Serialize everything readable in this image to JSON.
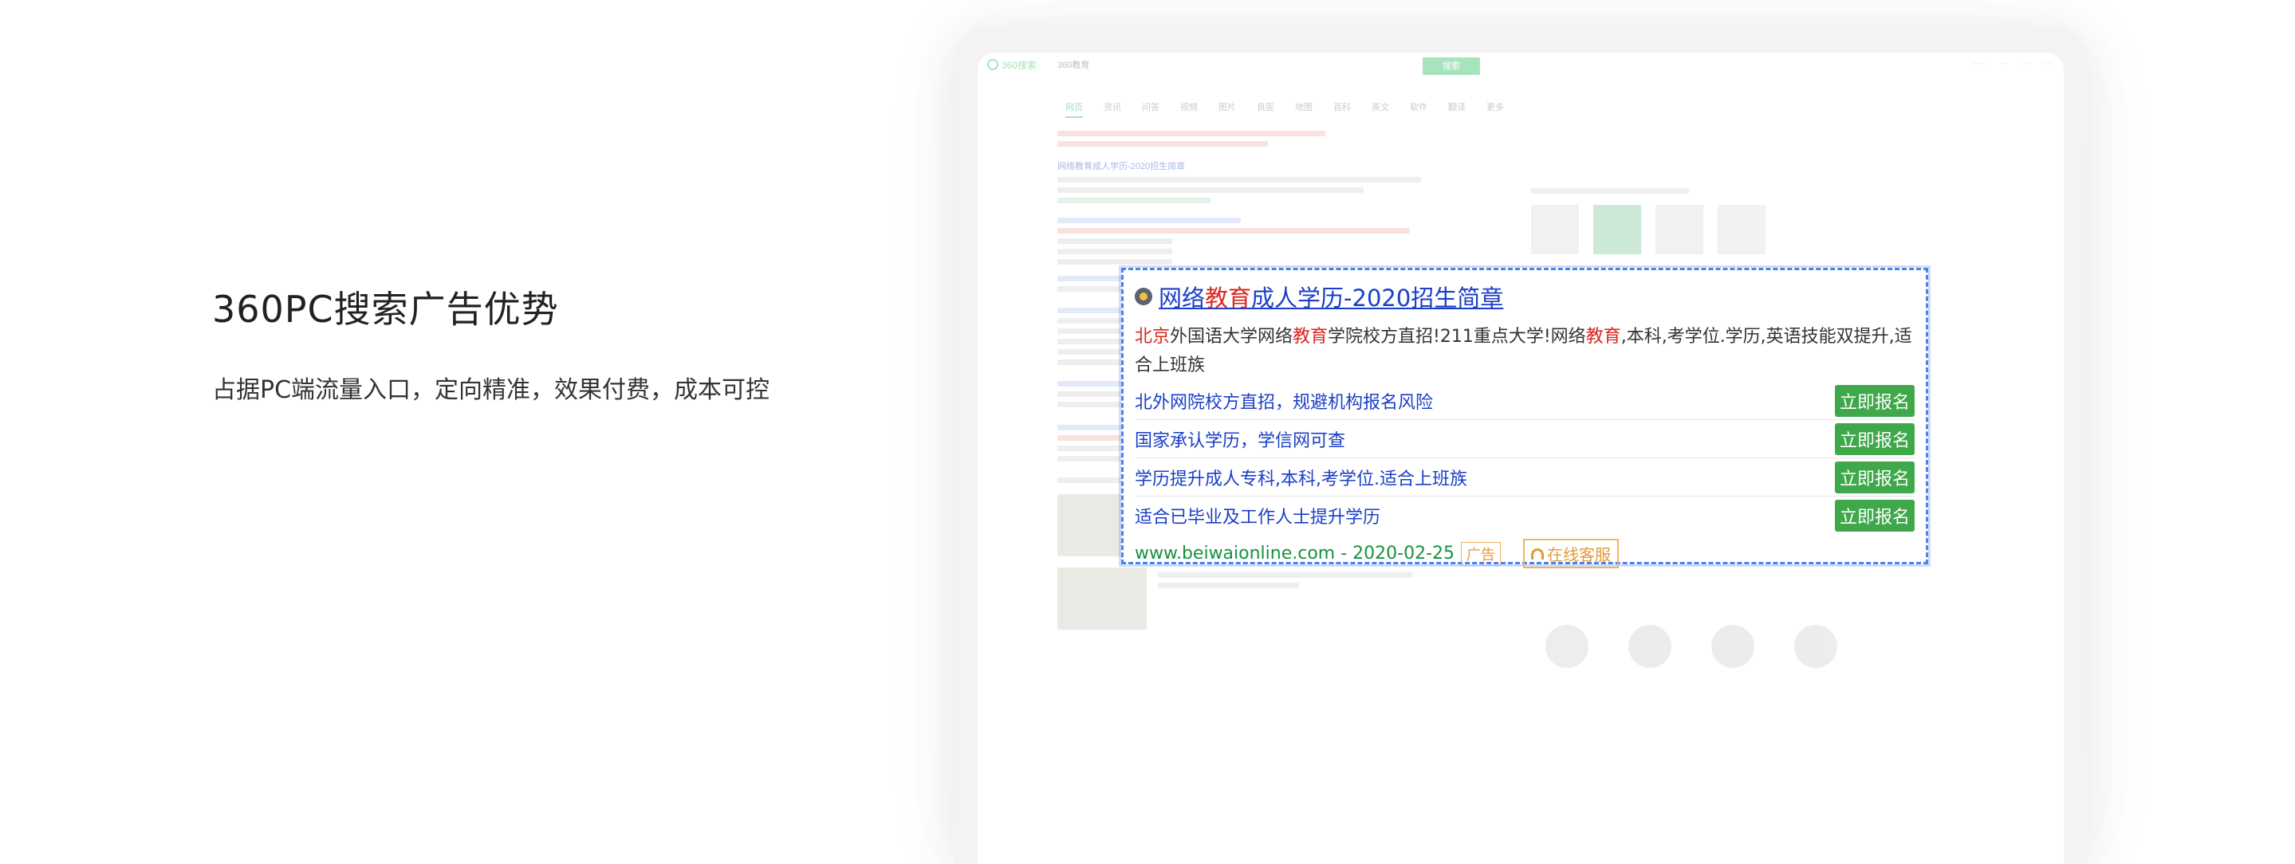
{
  "intro": {
    "title": "360PC搜索广告优势",
    "subtitle": "占据PC端流量入口，定向精准，效果付费，成本可控"
  },
  "ad": {
    "title_parts": [
      "网络",
      "教育",
      "成人学历-2020招生简章"
    ],
    "description_parts": [
      "北京",
      "外国语大学网络",
      "教育",
      "学院校方直招!211重点大学!网络",
      "教育",
      ",本科,考学位.学历,英语技能双提升,适合上班族"
    ],
    "sitelinks": [
      {
        "label": "北外网院校方直招，规避机构报名风险",
        "button": "立即报名"
      },
      {
        "label": "国家承认学历，学信网可查",
        "button": "立即报名"
      },
      {
        "label": "学历提升成人专科,本科,考学位.适合上班族",
        "button": "立即报名"
      },
      {
        "label": "适合已毕业及工作人士提升学历",
        "button": "立即报名"
      }
    ],
    "url": "www.beiwaionline.com - 2020-02-25",
    "ad_tag": "广告",
    "service_button": "在线客服"
  },
  "background": {
    "logo": "360搜索",
    "query": "360教育",
    "search_button": "搜索",
    "tabs": [
      "网页",
      "资讯",
      "问答",
      "视频",
      "图片",
      "良医",
      "地图",
      "百科",
      "英文",
      "软件",
      "翻译",
      "更多"
    ],
    "result_title": "网络教育成人学历-2020招生简章"
  },
  "colors": {
    "link": "#1a3ec8",
    "highlight": "#d9261e",
    "url": "#16923e",
    "button": "#3fa84a",
    "orange": "#e69a35",
    "dashed_border": "#4b82ee"
  }
}
